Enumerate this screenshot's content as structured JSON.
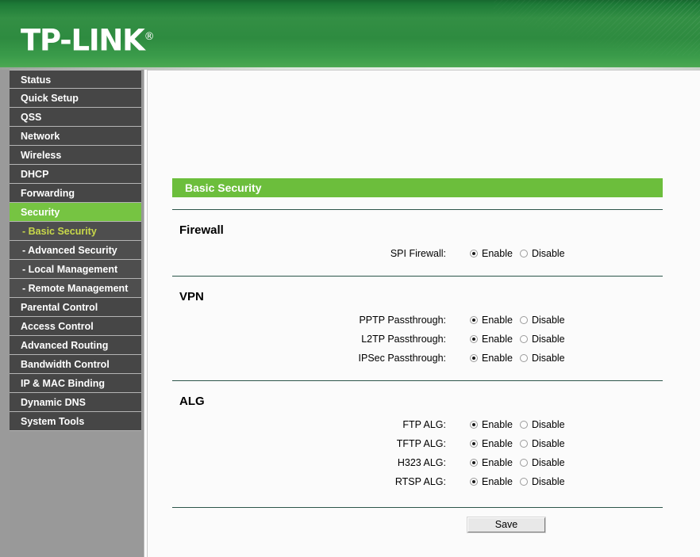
{
  "header": {
    "logo_text": "TP-LINK",
    "logo_registered": "®"
  },
  "sidebar": {
    "items": [
      {
        "label": "Status",
        "type": "main",
        "state": "normal"
      },
      {
        "label": "Quick Setup",
        "type": "main",
        "state": "normal"
      },
      {
        "label": "QSS",
        "type": "main",
        "state": "normal"
      },
      {
        "label": "Network",
        "type": "main",
        "state": "normal"
      },
      {
        "label": "Wireless",
        "type": "main",
        "state": "normal"
      },
      {
        "label": "DHCP",
        "type": "main",
        "state": "normal"
      },
      {
        "label": "Forwarding",
        "type": "main",
        "state": "normal"
      },
      {
        "label": "Security",
        "type": "main",
        "state": "selected"
      },
      {
        "label": "- Basic Security",
        "type": "sub",
        "state": "active"
      },
      {
        "label": "- Advanced Security",
        "type": "sub",
        "state": "normal"
      },
      {
        "label": "- Local Management",
        "type": "sub",
        "state": "normal"
      },
      {
        "label": "- Remote Management",
        "type": "sub",
        "state": "normal"
      },
      {
        "label": "Parental Control",
        "type": "main",
        "state": "normal"
      },
      {
        "label": "Access Control",
        "type": "main",
        "state": "normal"
      },
      {
        "label": "Advanced Routing",
        "type": "main",
        "state": "normal"
      },
      {
        "label": "Bandwidth Control",
        "type": "main",
        "state": "normal"
      },
      {
        "label": "IP & MAC Binding",
        "type": "main",
        "state": "normal"
      },
      {
        "label": "Dynamic DNS",
        "type": "main",
        "state": "normal"
      },
      {
        "label": "System Tools",
        "type": "main",
        "state": "normal"
      }
    ]
  },
  "main": {
    "page_title": "Basic Security",
    "sections": [
      {
        "title": "Firewall",
        "rows": [
          {
            "label": "SPI Firewall:",
            "selected": "Enable"
          }
        ]
      },
      {
        "title": "VPN",
        "rows": [
          {
            "label": "PPTP Passthrough:",
            "selected": "Enable"
          },
          {
            "label": "L2TP Passthrough:",
            "selected": "Enable"
          },
          {
            "label": "IPSec Passthrough:",
            "selected": "Enable"
          }
        ]
      },
      {
        "title": "ALG",
        "rows": [
          {
            "label": "FTP ALG:",
            "selected": "Enable"
          },
          {
            "label": "TFTP ALG:",
            "selected": "Enable"
          },
          {
            "label": "H323 ALG:",
            "selected": "Enable"
          },
          {
            "label": "RTSP ALG:",
            "selected": "Enable"
          }
        ]
      }
    ],
    "radio_options": [
      "Enable",
      "Disable"
    ],
    "save_label": "Save"
  },
  "colors": {
    "header_green": "#2e8b40",
    "banner_green": "#6cbe3c",
    "menu_selected_green": "#76c442",
    "submenu_active_text": "#c8d84a",
    "menu_bg": "#464646",
    "submenu_bg": "#4e4e4e",
    "sidebar_bg": "#999999",
    "rule_color": "#2c554a"
  }
}
